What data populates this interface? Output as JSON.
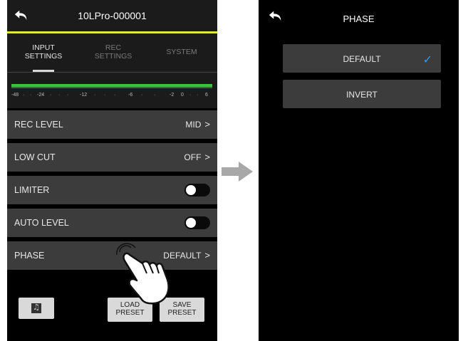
{
  "left_screen": {
    "title": "10LPro-000001",
    "tabs": [
      {
        "label_line1": "INPUT",
        "label_line2": "SETTINGS",
        "active": true
      },
      {
        "label_line1": "REC",
        "label_line2": "SETTINGS",
        "active": false
      },
      {
        "label_line1": "SYSTEM",
        "label_line2": "",
        "active": false
      }
    ],
    "meter": {
      "scale": [
        "-48",
        "·",
        "·",
        "-24",
        "·",
        "·",
        "·",
        "-12",
        "·",
        "·",
        "·",
        "-6",
        "·",
        "·",
        "-2",
        "0",
        "·",
        "·",
        "6"
      ]
    },
    "rows": [
      {
        "label": "REC LEVEL",
        "value": "MID",
        "chevron": ">"
      },
      {
        "label": "LOW CUT",
        "value": "OFF",
        "chevron": ">"
      },
      {
        "label": "LIMITER",
        "toggle": "off"
      },
      {
        "label": "AUTO LEVEL",
        "toggle": "off"
      },
      {
        "label": "PHASE",
        "value": "DEFAULT",
        "chevron": ">"
      }
    ],
    "buttons": {
      "file_icon": "music-file-icon",
      "load_line1": "LOAD",
      "load_line2": "PRESET",
      "save_line1": "SAVE",
      "save_line2": "PRESET"
    }
  },
  "right_screen": {
    "title": "PHASE",
    "options": [
      {
        "label": "DEFAULT",
        "selected": true
      },
      {
        "label": "INVERT",
        "selected": false
      }
    ],
    "check_mark": "✓"
  },
  "colors": {
    "accent_line": "#e7e63a",
    "meter_green": "#3bc243",
    "check_blue": "#2b9cf0",
    "row_bg": "#3c3c3c"
  }
}
